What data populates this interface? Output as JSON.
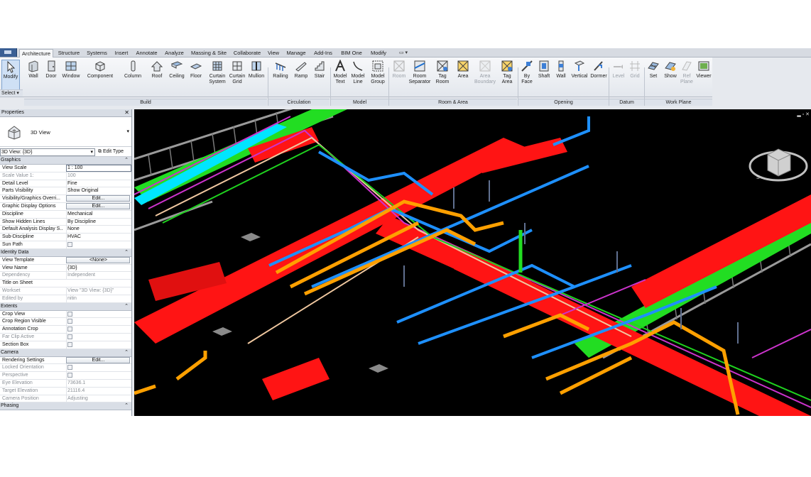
{
  "tabs": [
    "Architecture",
    "Structure",
    "Systems",
    "Insert",
    "Annotate",
    "Analyze",
    "Massing & Site",
    "Collaborate",
    "View",
    "Manage",
    "Add-Ins",
    "BIM One",
    "Modify"
  ],
  "ribbon": {
    "select": {
      "modify": "Modify",
      "select_label": "Select"
    },
    "build": {
      "panel": "Build",
      "wall": "Wall",
      "door": "Door",
      "window": "Window",
      "component": "Component",
      "column": "Column",
      "roof": "Roof",
      "ceiling": "Ceiling",
      "floor": "Floor",
      "curtain_system_1": "Curtain",
      "curtain_system_2": "System",
      "curtain_grid_1": "Curtain",
      "curtain_grid_2": "Grid",
      "mullion": "Mullion"
    },
    "circulation": {
      "panel": "Circulation",
      "railing": "Railing",
      "ramp": "Ramp",
      "stair": "Stair"
    },
    "model": {
      "panel": "Model",
      "model_text_1": "Model",
      "model_text_2": "Text",
      "model_line_1": "Model",
      "model_line_2": "Line",
      "model_group_1": "Model",
      "model_group_2": "Group"
    },
    "room_area": {
      "panel": "Room & Area",
      "room": "Room",
      "room_sep_1": "Room",
      "room_sep_2": "Separator",
      "tag_room_1": "Tag",
      "tag_room_2": "Room",
      "area": "Area",
      "area_boundary_1": "Area",
      "area_boundary_2": "Boundary",
      "tag_area_1": "Tag",
      "tag_area_2": "Area"
    },
    "opening": {
      "panel": "Opening",
      "by_face_1": "By",
      "by_face_2": "Face",
      "shaft": "Shaft",
      "wall": "Wall",
      "vertical": "Vertical",
      "dormer": "Dormer"
    },
    "datum": {
      "panel": "Datum",
      "level": "Level",
      "grid": "Grid"
    },
    "work_plane": {
      "panel": "Work Plane",
      "set": "Set",
      "show": "Show",
      "ref_plane_1": "Ref",
      "ref_plane_2": "Plane",
      "viewer": "Viewer"
    }
  },
  "properties": {
    "title": "Properties",
    "type_name": "3D View",
    "view_selector": "3D View: {3D}",
    "edit_type": "Edit Type",
    "sections": {
      "graphics": "Graphics",
      "identity": "Identity Data",
      "extents": "Extents",
      "camera": "Camera",
      "phasing": "Phasing"
    },
    "graphics": [
      {
        "k": "View Scale",
        "v": "1 : 100"
      },
      {
        "k": "Scale Value    1:",
        "v": "100"
      },
      {
        "k": "Detail Level",
        "v": "Fine"
      },
      {
        "k": "Parts Visibility",
        "v": "Show Original"
      },
      {
        "k": "Visibility/Graphics Overri...",
        "v": "Edit..."
      },
      {
        "k": "Graphic Display Options",
        "v": "Edit..."
      },
      {
        "k": "Discipline",
        "v": "Mechanical"
      },
      {
        "k": "Show Hidden Lines",
        "v": "By Discipline"
      },
      {
        "k": "Default Analysis Display S...",
        "v": "None"
      },
      {
        "k": "Sub-Discipline",
        "v": "HVAC"
      },
      {
        "k": "Sun Path",
        "v": ""
      }
    ],
    "identity": [
      {
        "k": "View Template",
        "v": "<None>"
      },
      {
        "k": "View Name",
        "v": "{3D}"
      },
      {
        "k": "Dependency",
        "v": "Independent"
      },
      {
        "k": "Title on Sheet",
        "v": ""
      },
      {
        "k": "Workset",
        "v": "View \"3D View: {3D}\""
      },
      {
        "k": "Edited by",
        "v": "nitin"
      }
    ],
    "extents": [
      {
        "k": "Crop View",
        "v": ""
      },
      {
        "k": "Crop Region Visible",
        "v": ""
      },
      {
        "k": "Annotation Crop",
        "v": ""
      },
      {
        "k": "Far Clip Active",
        "v": ""
      },
      {
        "k": "Section Box",
        "v": ""
      }
    ],
    "camera": [
      {
        "k": "Rendering Settings",
        "v": "Edit..."
      },
      {
        "k": "Locked Orientation",
        "v": ""
      },
      {
        "k": "Perspective",
        "v": ""
      },
      {
        "k": "Eye Elevation",
        "v": "73636.1"
      },
      {
        "k": "Target Elevation",
        "v": "21116.4"
      },
      {
        "k": "Camera Position",
        "v": "Adjusting"
      }
    ]
  },
  "colors": {
    "duct": "#ff1a1a",
    "pipe_orange": "#ffa000",
    "pipe_blue": "#1e90ff",
    "green": "#22ee22",
    "cyan": "#00ffff",
    "magenta": "#cc33cc",
    "tray": "#b0b0b0"
  }
}
